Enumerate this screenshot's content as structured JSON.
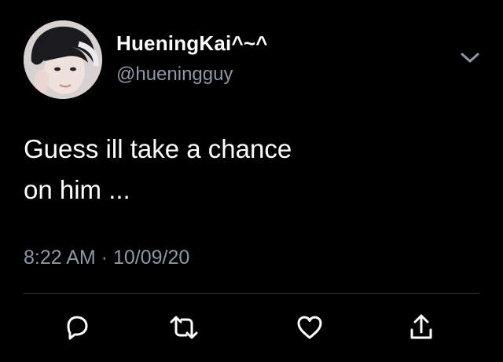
{
  "tweet": {
    "display_name": "HueningKai^~^",
    "handle": "@hueningguy",
    "text_lines": [
      "Guess ill take a chance",
      "on him ..."
    ],
    "timestamp": "8:22 AM · 10/09/20"
  },
  "icons": {
    "more": "chevron-down-icon",
    "reply": "reply-icon",
    "retweet": "retweet-icon",
    "like": "heart-icon",
    "share": "share-icon"
  },
  "colors": {
    "background": "#000000",
    "primary_text": "#ffffff",
    "secondary_text": "#8b98a5",
    "divider": "#2f3336"
  }
}
